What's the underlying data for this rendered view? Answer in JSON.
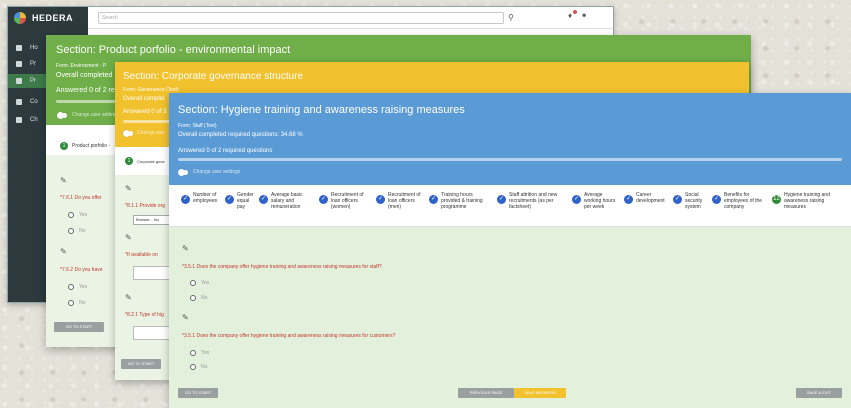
{
  "app": {
    "brand": "HEDERA",
    "search_placeholder": "Search",
    "nav": [
      {
        "label": "Ho",
        "icon": "dashboard-icon"
      },
      {
        "label": "Pr",
        "icon": "user-icon"
      },
      {
        "label": "Pr",
        "icon": "leaf-icon"
      },
      {
        "label": "Co",
        "icon": "company-icon"
      },
      {
        "label": "Ch",
        "icon": "chat-icon"
      }
    ]
  },
  "green": {
    "title": "Section: Product porfolio - environmental impact",
    "form": "Form: Environment - P",
    "overall": "Overall completed",
    "answered": "Answered 0 of 2 re",
    "toggle": "Change user settings",
    "step_tab": "Product porfolio -",
    "q1": "*7.6.1 Do you offer",
    "q2": "*7.6.2 Do you have",
    "yes": "Yes",
    "no": "No",
    "go_to_start": "GO TO START",
    "color": "#6fae48"
  },
  "yellow": {
    "title": "Section: Corporate governance structure",
    "form": "Form: Governance (Test)",
    "overall": "Overall complet",
    "answered": "Answered 0 of 3",
    "toggle": "Change use",
    "step_tab": "Corporate gove",
    "q1": "*8.1.1 Provide org",
    "browse": "Browse... No",
    "q2": "*If available on",
    "q3": "*8.2.1 Type of hig",
    "go_to_start": "GO TO START",
    "color": "#f2c12e"
  },
  "blue": {
    "title": "Section: Hygiene training and awareness raising measures",
    "form": "Form: Staff (Test)",
    "overall": "Overall completed required questions: 34.68 %",
    "answered": "Answered 0 of 2 required questions",
    "toggle": "Change user settings",
    "steps": [
      {
        "label": "Number of\nemployees",
        "current": false
      },
      {
        "label": "Gender\nequal\npay",
        "current": false
      },
      {
        "label": "Average basic\nsalary and\nremuneration",
        "current": false
      },
      {
        "label": "Recruitment of\nloan officers\n(women)",
        "current": false
      },
      {
        "label": "Recruitment of\nloan officers\n(men)",
        "current": false
      },
      {
        "label": "Training hours\nprovided & training\nprogramme",
        "current": false
      },
      {
        "label": "Staff attrition and new\nrecruitments (as per\nfactsheet)",
        "current": false
      },
      {
        "label": "Average\nworking hours\nper week",
        "current": false
      },
      {
        "label": "Career\ndevelopment",
        "current": false
      },
      {
        "label": "Social\nsecurity\nsystem",
        "current": false
      },
      {
        "label": "Benefits for\nemployees of the\ncompany",
        "current": false
      },
      {
        "label": "Hygiene training and\nawareness raising\nmeasures",
        "current": true,
        "num": "12"
      }
    ],
    "q1": "*3.5.1 Does the company offer hygiene training and awareness raising measures for staff?",
    "q2": "*3.5.1 Does the company offer hygiene training and awareness raising measures for customers?",
    "yes": "Yes",
    "no": "No",
    "go_to_start": "GO TO START",
    "previous_page": "PREVIOUS PAGE",
    "save_answers": "SAVE ANSWERS",
    "save_exit": "SAVE & EXIT",
    "color": "#5b9bd5"
  }
}
